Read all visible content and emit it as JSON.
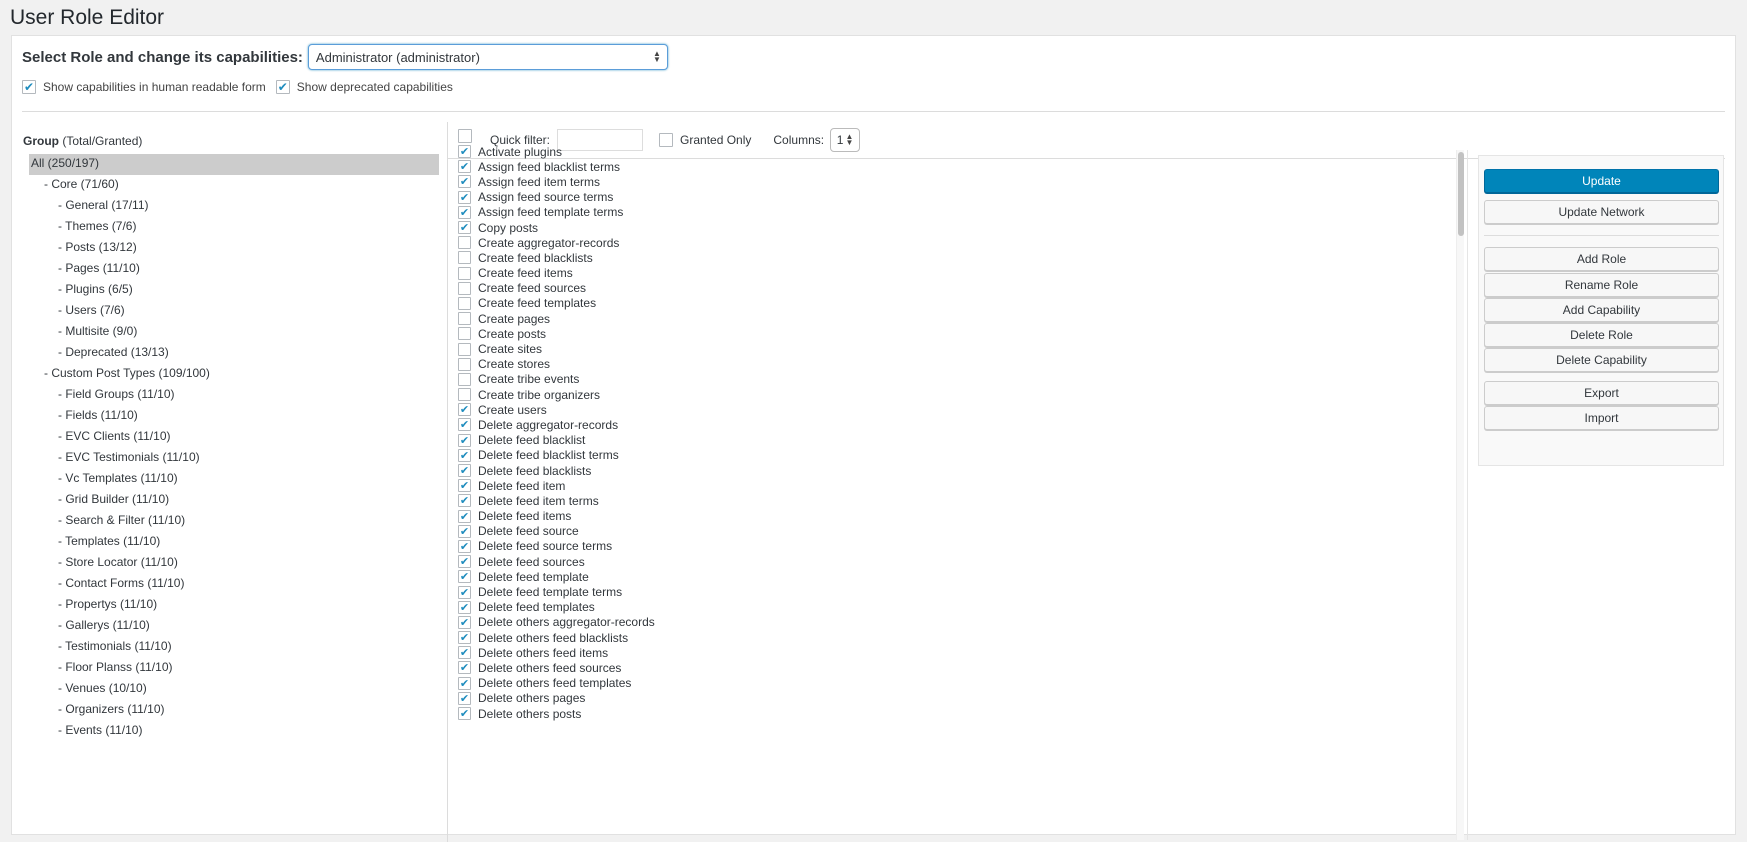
{
  "page": {
    "title": "User Role Editor"
  },
  "role_select": {
    "label": "Select Role and change its capabilities:",
    "value": "Administrator (administrator)"
  },
  "options": {
    "human_readable_label": "Show capabilities in human readable form",
    "human_readable_checked": true,
    "deprecated_label": "Show deprecated capabilities",
    "deprecated_checked": true
  },
  "group_header": {
    "title": "Group",
    "subtitle": "(Total/Granted)"
  },
  "filter": {
    "quick_filter_label": "Quick filter:",
    "quick_filter_value": "",
    "granted_only_label": "Granted Only",
    "granted_only_checked": false,
    "columns_label": "Columns:",
    "columns_value": "1"
  },
  "groups": [
    {
      "label": "All (250/197)",
      "level": 0,
      "selected": true
    },
    {
      "label": "- Core (71/60)",
      "level": 1
    },
    {
      "label": "- General (17/11)",
      "level": 2
    },
    {
      "label": "- Themes (7/6)",
      "level": 2
    },
    {
      "label": "- Posts (13/12)",
      "level": 2
    },
    {
      "label": "- Pages (11/10)",
      "level": 2
    },
    {
      "label": "- Plugins (6/5)",
      "level": 2
    },
    {
      "label": "- Users (7/6)",
      "level": 2
    },
    {
      "label": "- Multisite (9/0)",
      "level": 2
    },
    {
      "label": "- Deprecated (13/13)",
      "level": 2
    },
    {
      "label": "- Custom Post Types (109/100)",
      "level": 1
    },
    {
      "label": "- Field Groups (11/10)",
      "level": 2
    },
    {
      "label": "- Fields (11/10)",
      "level": 2
    },
    {
      "label": "- EVC Clients (11/10)",
      "level": 2
    },
    {
      "label": "- EVC Testimonials (11/10)",
      "level": 2
    },
    {
      "label": "- Vc Templates (11/10)",
      "level": 2
    },
    {
      "label": "- Grid Builder (11/10)",
      "level": 2
    },
    {
      "label": "- Search & Filter (11/10)",
      "level": 2
    },
    {
      "label": "- Templates (11/10)",
      "level": 2
    },
    {
      "label": "- Store Locator (11/10)",
      "level": 2
    },
    {
      "label": "- Contact Forms (11/10)",
      "level": 2
    },
    {
      "label": "- Propertys (11/10)",
      "level": 2
    },
    {
      "label": "- Gallerys (11/10)",
      "level": 2
    },
    {
      "label": "- Testimonials (11/10)",
      "level": 2
    },
    {
      "label": "- Floor Planss (11/10)",
      "level": 2
    },
    {
      "label": "- Venues (10/10)",
      "level": 2
    },
    {
      "label": "- Organizers (11/10)",
      "level": 2
    },
    {
      "label": "- Events (11/10)",
      "level": 2
    }
  ],
  "capabilities": [
    {
      "label": "Activate plugins",
      "checked": true
    },
    {
      "label": "Assign feed blacklist terms",
      "checked": true
    },
    {
      "label": "Assign feed item terms",
      "checked": true
    },
    {
      "label": "Assign feed source terms",
      "checked": true
    },
    {
      "label": "Assign feed template terms",
      "checked": true
    },
    {
      "label": "Copy posts",
      "checked": true
    },
    {
      "label": "Create aggregator-records",
      "checked": false
    },
    {
      "label": "Create feed blacklists",
      "checked": false
    },
    {
      "label": "Create feed items",
      "checked": false
    },
    {
      "label": "Create feed sources",
      "checked": false
    },
    {
      "label": "Create feed templates",
      "checked": false
    },
    {
      "label": "Create pages",
      "checked": false
    },
    {
      "label": "Create posts",
      "checked": false
    },
    {
      "label": "Create sites",
      "checked": false
    },
    {
      "label": "Create stores",
      "checked": false
    },
    {
      "label": "Create tribe events",
      "checked": false
    },
    {
      "label": "Create tribe organizers",
      "checked": false
    },
    {
      "label": "Create users",
      "checked": true
    },
    {
      "label": "Delete aggregator-records",
      "checked": true
    },
    {
      "label": "Delete feed blacklist",
      "checked": true
    },
    {
      "label": "Delete feed blacklist terms",
      "checked": true
    },
    {
      "label": "Delete feed blacklists",
      "checked": true
    },
    {
      "label": "Delete feed item",
      "checked": true
    },
    {
      "label": "Delete feed item terms",
      "checked": true
    },
    {
      "label": "Delete feed items",
      "checked": true
    },
    {
      "label": "Delete feed source",
      "checked": true
    },
    {
      "label": "Delete feed source terms",
      "checked": true
    },
    {
      "label": "Delete feed sources",
      "checked": true
    },
    {
      "label": "Delete feed template",
      "checked": true
    },
    {
      "label": "Delete feed template terms",
      "checked": true
    },
    {
      "label": "Delete feed templates",
      "checked": true
    },
    {
      "label": "Delete others aggregator-records",
      "checked": true
    },
    {
      "label": "Delete others feed blacklists",
      "checked": true
    },
    {
      "label": "Delete others feed items",
      "checked": true
    },
    {
      "label": "Delete others feed sources",
      "checked": true
    },
    {
      "label": "Delete others feed templates",
      "checked": true
    },
    {
      "label": "Delete others pages",
      "checked": true
    },
    {
      "label": "Delete others posts",
      "checked": true
    }
  ],
  "actions": {
    "update": "Update",
    "update_network": "Update Network",
    "add_role": "Add Role",
    "rename_role": "Rename Role",
    "add_capability": "Add Capability",
    "delete_role": "Delete Role",
    "delete_capability": "Delete Capability",
    "export": "Export",
    "import": "Import"
  },
  "colors": {
    "primary": "#0085ba",
    "check": "#1e8cbe",
    "selected_row": "#cccccc"
  }
}
